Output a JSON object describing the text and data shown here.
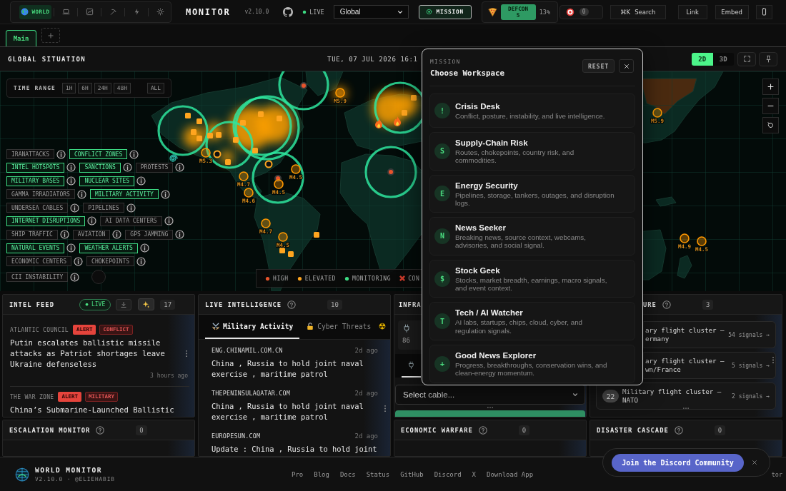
{
  "top_bar": {
    "variants": [
      {
        "kind": "globe",
        "label": "WORLD",
        "selected": true
      },
      {
        "kind": "laptop",
        "selected": false
      },
      {
        "kind": "chart",
        "selected": false
      },
      {
        "kind": "pickaxe",
        "selected": false
      },
      {
        "kind": "bolt",
        "selected": false
      },
      {
        "kind": "sun",
        "selected": false
      }
    ],
    "title": "MONITOR",
    "version": "v2.10.0",
    "live": "LIVE",
    "region": {
      "value": "Global"
    },
    "mission": "MISSION",
    "defcon": {
      "label": "DEFCON",
      "value": "5",
      "percent": "13%"
    },
    "alerts": "0",
    "search": {
      "shortcut": "⌘K",
      "label": "Search"
    },
    "buttons": [
      "Link",
      "Embed"
    ]
  },
  "workspace_tabs": [
    {
      "label": "Main",
      "selected": true
    }
  ],
  "map_panel": {
    "title": "GLOBAL SITUATION",
    "datetime": "TUE, 07 JUL 2026 16:1",
    "view_modes": [
      {
        "label": "2D",
        "selected": true
      },
      {
        "label": "3D",
        "selected": false
      }
    ],
    "time_range": {
      "label": "TIME RANGE",
      "options": [
        {
          "label": "1H",
          "selected": false
        },
        {
          "label": "6H",
          "selected": false
        },
        {
          "label": "24H",
          "selected": false
        },
        {
          "label": "48H",
          "selected": false
        },
        {
          "label": "ALL",
          "selected": false
        }
      ]
    },
    "layers": [
      {
        "label": "IRANATTACKS",
        "on": false
      },
      {
        "label": "CONFLICT ZONES",
        "on": true
      },
      {
        "label": "INTEL HOTSPOTS",
        "on": true
      },
      {
        "label": "SANCTIONS",
        "on": true
      },
      {
        "label": "PROTESTS",
        "on": false
      },
      {
        "label": "MILITARY BASES",
        "on": true
      },
      {
        "label": "NUCLEAR SITES",
        "on": true
      },
      {
        "label": "GAMMA IRRADIATORS",
        "on": false
      },
      {
        "label": "MILITARY ACTIVITY",
        "on": true
      },
      {
        "label": "UNDERSEA CABLES",
        "on": false
      },
      {
        "label": "PIPELINES",
        "on": false
      },
      {
        "label": "INTERNET DISRUPTIONS",
        "on": true
      },
      {
        "label": "AI DATA CENTERS",
        "on": false
      },
      {
        "label": "SHIP TRAFFIC",
        "on": false
      },
      {
        "label": "AVIATION",
        "on": false
      },
      {
        "label": "GPS JAMMING",
        "on": false
      },
      {
        "label": "NATURAL EVENTS",
        "on": true
      },
      {
        "label": "WEATHER ALERTS",
        "on": true
      },
      {
        "label": "ECONOMIC CENTERS",
        "on": false
      },
      {
        "label": "CHOKEPOINTS",
        "on": false
      },
      {
        "label": "CII INSTABILITY",
        "on": false
      }
    ],
    "quakes": [
      {
        "label": "M5.9"
      },
      {
        "label": "M5.3"
      },
      {
        "label": "M4.5"
      },
      {
        "label": "M4.7"
      },
      {
        "label": "M4.5"
      },
      {
        "label": "M4.6"
      },
      {
        "label": "M4.7"
      },
      {
        "label": "M4.5"
      },
      {
        "label": "M5.9"
      },
      {
        "label": "M4.9"
      },
      {
        "label": "M4.5"
      }
    ],
    "legend": [
      {
        "kind": "dot",
        "label": "HIGH",
        "color": "#e8542c"
      },
      {
        "kind": "dot",
        "label": "ELEVATED",
        "color": "#ffa51f"
      },
      {
        "kind": "dot",
        "label": "MONITORING",
        "color": "#3ddc84"
      },
      {
        "kind": "cross",
        "label": "CON",
        "color": "#c83a2a"
      }
    ]
  },
  "intel_feed": {
    "title": "INTEL FEED",
    "live": "LIVE",
    "count": "17",
    "items": [
      {
        "source": "ATLANTIC COUNCIL",
        "tags": [
          {
            "kind": "alert",
            "label": "ALERT"
          },
          {
            "kind": "topic",
            "label": "CONFLICT"
          }
        ],
        "headline": "Putin escalates ballistic missile attacks as Patriot shortages leave Ukraine defenseless",
        "time": "3 hours ago",
        "menu": true
      },
      {
        "source": "THE WAR ZONE",
        "tags": [
          {
            "kind": "alert",
            "label": "ALERT"
          },
          {
            "kind": "topic",
            "label": "MILITARY"
          }
        ],
        "headline": "China’s Submarine-Launched Ballistic",
        "menu": false
      }
    ]
  },
  "live_intelligence": {
    "title": "LIVE INTELLIGENCE",
    "count": "10",
    "tabs": [
      {
        "kind": "swords",
        "label": "Military Activity",
        "selected": true
      },
      {
        "kind": "lock",
        "label": "Cyber Threats",
        "selected": false
      },
      {
        "kind": "radiation",
        "selected": false
      }
    ],
    "items": [
      {
        "source": "ENG.CHINAMIL.COM.CN",
        "time": "2d ago",
        "headline": "China , Russia to hold joint naval exercise , maritime patrol",
        "menu": false
      },
      {
        "source": "THEPENINSULAQATAR.COM",
        "time": "2d ago",
        "headline": "China , Russia to hold joint naval exercise , maritime patrol",
        "menu": true
      },
      {
        "source": "EUROPESUN.COM",
        "time": "2d ago",
        "headline": "Update : China , Russia to hold joint",
        "menu": false
      }
    ]
  },
  "infrastructure": {
    "title": "INFRA",
    "stat": "86",
    "tabs": [
      {
        "kind": "plug",
        "selected": true
      }
    ],
    "select": {
      "placeholder": "Select cable..."
    }
  },
  "posture": {
    "title": "URE",
    "count": "3",
    "items": [
      {
        "title": "ary flight cluster — ermany",
        "signals": "54 signals →",
        "menu": false
      },
      {
        "title": "ary flight cluster — wn/France",
        "signals": "5 signals →",
        "menu": true
      },
      {
        "count": "22",
        "title": "Military flight cluster — NATO",
        "signals": "2 signals →",
        "menu": false
      }
    ]
  },
  "lower_panels": [
    {
      "title": "ESCALATION MONITOR",
      "count": "0"
    },
    {
      "title": "ECONOMIC WARFARE",
      "count": "0"
    },
    {
      "title": "DISASTER CASCADE",
      "count": "0"
    }
  ],
  "mission_dialog": {
    "eyebrow": "MISSION",
    "title": "Choose Workspace",
    "reset": "RESET",
    "options": [
      {
        "badge": "!",
        "title": "Crisis Desk",
        "description": "Conflict, posture, instability, and live intelligence."
      },
      {
        "badge": "S",
        "title": "Supply-Chain Risk",
        "description": "Routes, chokepoints, country risk, and commodities."
      },
      {
        "badge": "E",
        "title": "Energy Security",
        "description": "Pipelines, storage, tankers, outages, and disruption logs."
      },
      {
        "badge": "N",
        "title": "News Seeker",
        "description": "Breaking news, source context, webcams, advisories, and social signal."
      },
      {
        "badge": "$",
        "title": "Stock Geek",
        "description": "Stocks, market breadth, earnings, macro signals, and event context."
      },
      {
        "badge": "T",
        "title": "Tech / AI Watcher",
        "description": "AI labs, startups, chips, cloud, cyber, and regulation signals."
      },
      {
        "badge": "+",
        "title": "Good News Explorer",
        "description": "Progress, breakthroughs, conservation wins, and clean-energy momentum."
      }
    ]
  },
  "footer": {
    "brand": "WORLD MONITOR",
    "meta": "V2.10.0 · @ELIEHABIB",
    "links": [
      "Pro",
      "Blog",
      "Docs",
      "Status",
      "GitHub",
      "Discord",
      "X",
      "Download App"
    ],
    "trailing": "tor"
  },
  "discord_toast": {
    "button": "Join the Discord Community"
  }
}
